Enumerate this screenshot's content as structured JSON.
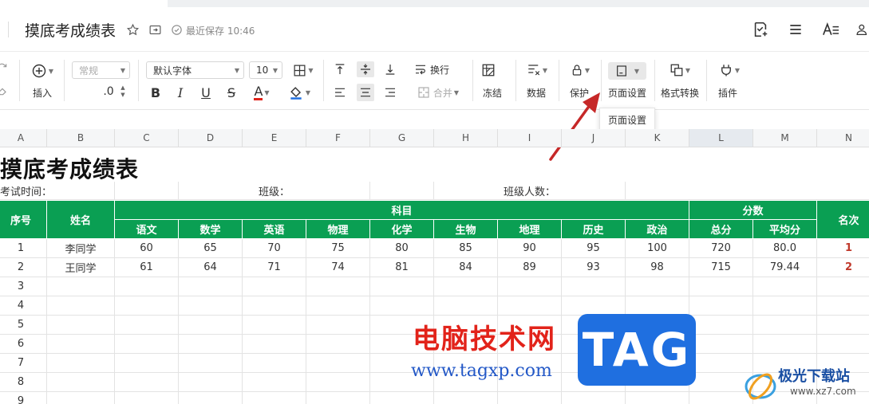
{
  "header": {
    "doc_title": "摸底考成绩表",
    "save_status": "最近保存 10:46",
    "icons": [
      "star-icon",
      "folder-move-icon",
      "check-circle-icon",
      "edit-doc-icon",
      "menu-icon",
      "text-size-icon",
      "user-icon"
    ]
  },
  "toolbar": {
    "insert_label": "插入",
    "number_format": "常规",
    "decimal_label": ".0",
    "font_family": "默认字体",
    "font_size": "10",
    "wrap_label": "换行",
    "merge_label": "合并",
    "freeze_label": "冻结",
    "data_label": "数据",
    "protect_label": "保护",
    "page_setup_label": "页面设置",
    "format_convert_label": "格式转换",
    "plugin_label": "插件",
    "bold": "B",
    "italic": "I",
    "underline": "U",
    "strike": "S",
    "font_color": "A"
  },
  "tooltip": "页面设置",
  "columns": [
    "A",
    "B",
    "C",
    "D",
    "E",
    "F",
    "G",
    "H",
    "I",
    "J",
    "K",
    "L",
    "M",
    "N"
  ],
  "sheet": {
    "title": "摸底考成绩表",
    "info_exam_time": "考试时间：",
    "info_class": "班级：",
    "info_class_count": "班级人数：",
    "header_no": "序号",
    "header_name": "姓名",
    "header_subjects": "科目",
    "header_scores": "分数",
    "header_rank": "名次",
    "subjects": [
      "语文",
      "数学",
      "英语",
      "物理",
      "化学",
      "生物",
      "地理",
      "历史",
      "政治"
    ],
    "score_headers": [
      "总分",
      "平均分"
    ],
    "rows": [
      {
        "no": "1",
        "name": "李同学",
        "scores": [
          "60",
          "65",
          "70",
          "75",
          "80",
          "85",
          "90",
          "95",
          "100"
        ],
        "total": "720",
        "avg": "80.0",
        "rank": "1"
      },
      {
        "no": "2",
        "name": "王同学",
        "scores": [
          "61",
          "64",
          "71",
          "74",
          "81",
          "84",
          "89",
          "93",
          "98"
        ],
        "total": "715",
        "avg": "79.44",
        "rank": "2"
      }
    ],
    "empty_rows": [
      "3",
      "4",
      "5",
      "6",
      "7",
      "8",
      "9"
    ]
  },
  "watermark": {
    "cn": "电脑技术网",
    "url": "www.tagxp.com",
    "tag": "TAG",
    "site_cn": "极光下载站",
    "site_url": "www.xz7.com"
  },
  "colors": {
    "header_green": "#0a9f53",
    "rank_red": "#c0392b",
    "accent_arrow": "#c62828"
  }
}
